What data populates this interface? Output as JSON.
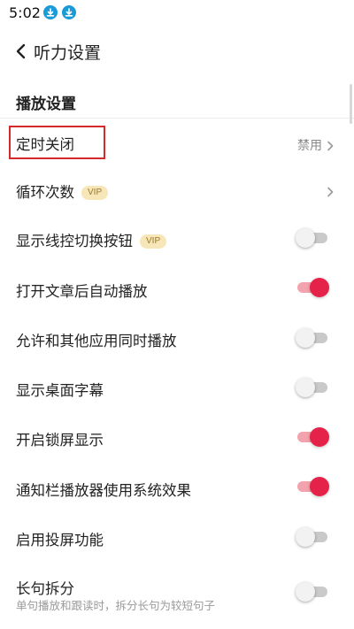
{
  "status": {
    "time": "5:02",
    "icons": [
      "download-icon",
      "download-icon"
    ]
  },
  "header": {
    "title": "听力设置",
    "back_icon": "back-arrow-icon"
  },
  "section": {
    "title": "播放设置"
  },
  "rows": [
    {
      "label": "定时关闭",
      "value": "禁用",
      "chevron": true
    },
    {
      "label": "循环次数",
      "badge": "VIP",
      "chevron": true
    },
    {
      "label": "显示线控切换按钮",
      "badge": "VIP",
      "toggle": false
    },
    {
      "label": "打开文章后自动播放",
      "toggle": true
    },
    {
      "label": "允许和其他应用同时播放",
      "toggle": false
    },
    {
      "label": "显示桌面字幕",
      "toggle": false
    },
    {
      "label": "开启锁屏显示",
      "toggle": true
    },
    {
      "label": "通知栏播放器使用系统效果",
      "toggle": true
    },
    {
      "label": "启用投屏功能",
      "toggle": false
    },
    {
      "label": "长句拆分",
      "sublabel": "单句播放和跟读时，拆分长句为较短句子",
      "toggle": false
    }
  ],
  "colors": {
    "accent": "#e5234a",
    "highlight_box": "#d42a2a",
    "status_icon": "#1a9bd7"
  }
}
